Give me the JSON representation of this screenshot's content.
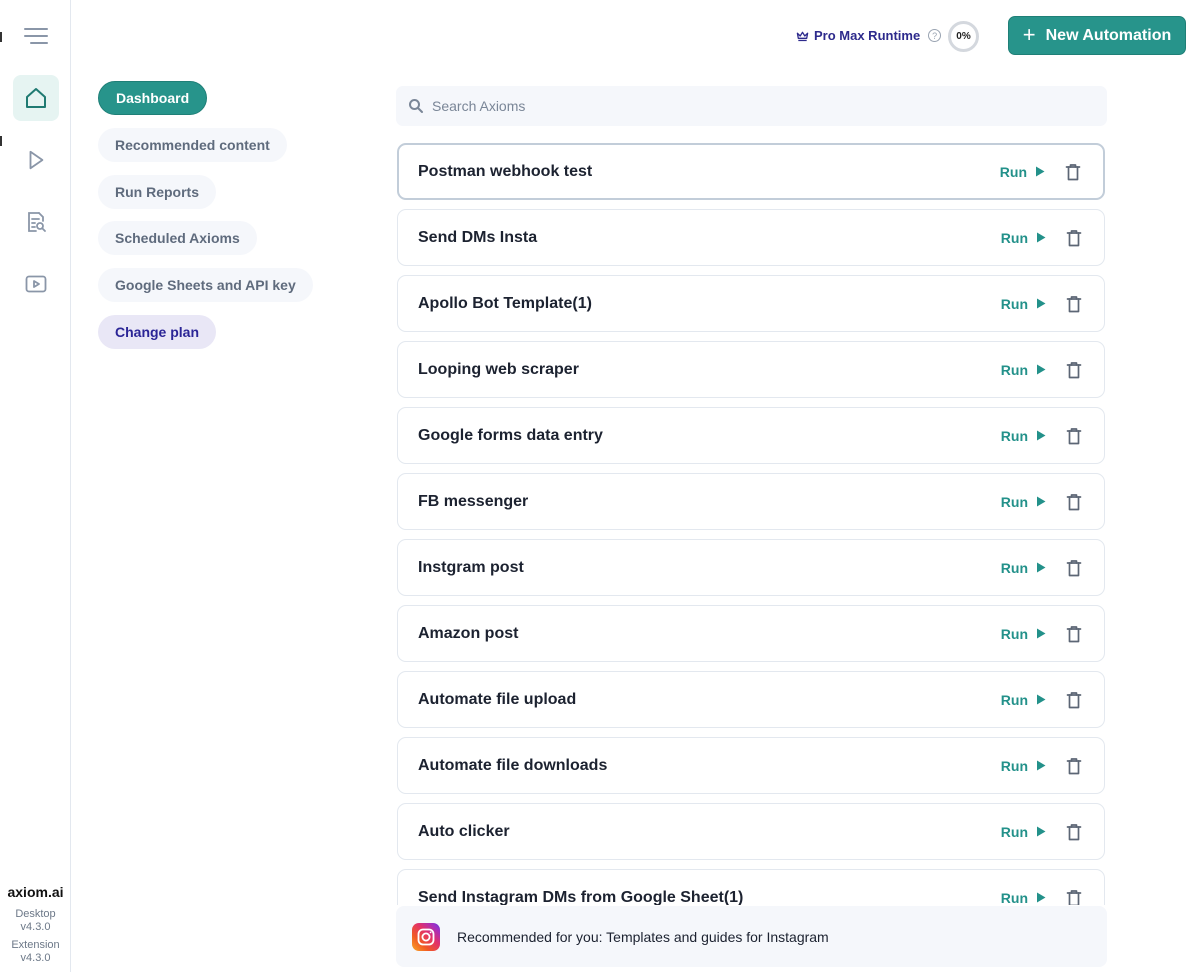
{
  "rail": {
    "menu_icon": "hamburger-icon",
    "items": [
      {
        "icon": "home-icon",
        "label": "Home",
        "active": true
      },
      {
        "icon": "play-icon",
        "label": "Run"
      },
      {
        "icon": "report-search-icon",
        "label": "Reports"
      },
      {
        "icon": "video-icon",
        "label": "Tutorials"
      }
    ],
    "brand": "axiom.ai",
    "desktop_label": "Desktop",
    "desktop_version": "v4.3.0",
    "extension_label": "Extension",
    "extension_version": "v4.3.0"
  },
  "header": {
    "plan_icon": "crown-icon",
    "plan_label": "Pro Max Runtime",
    "help_icon": "?",
    "usage_percent": "0%",
    "new_button_icon": "+",
    "new_button_label": "New Automation"
  },
  "subnav": {
    "items": [
      {
        "label": "Dashboard",
        "active": true
      },
      {
        "label": "Recommended content"
      },
      {
        "label": "Run Reports"
      },
      {
        "label": "Scheduled Axioms"
      },
      {
        "label": "Google Sheets and API key"
      },
      {
        "label": "Change plan"
      }
    ]
  },
  "search": {
    "placeholder": "Search Axioms",
    "value": ""
  },
  "axioms": {
    "run_label": "Run",
    "items": [
      {
        "name": "Postman webhook test",
        "selected": true
      },
      {
        "name": "Send DMs Insta"
      },
      {
        "name": "Apollo Bot Template(1)"
      },
      {
        "name": "Looping web scraper"
      },
      {
        "name": "Google forms data entry"
      },
      {
        "name": "FB messenger"
      },
      {
        "name": "Instgram post"
      },
      {
        "name": "Amazon post"
      },
      {
        "name": "Automate file upload"
      },
      {
        "name": "Automate file downloads"
      },
      {
        "name": "Auto clicker"
      },
      {
        "name": "Send Instagram DMs from Google Sheet(1)"
      }
    ]
  },
  "recommendation": {
    "icon": "instagram-icon",
    "text": "Recommended for you: Templates and guides for Instagram"
  },
  "colors": {
    "accent": "#27948b",
    "plan_text": "#2d2a8c",
    "pill_bg": "#f5f7fb",
    "change_plan_bg": "#e9e7f6"
  }
}
